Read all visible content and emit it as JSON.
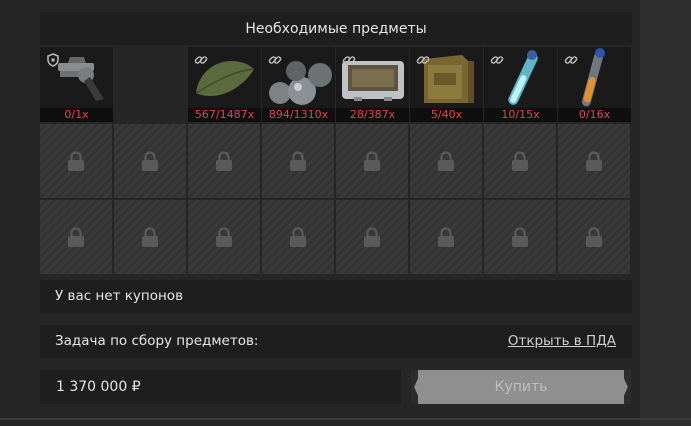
{
  "header": {
    "title": "Необходимые предметы"
  },
  "items": [
    {
      "name": "revolver",
      "count": "0/1x",
      "tag": "shield-icon"
    },
    {
      "name": "leaf",
      "count": "567/1487x",
      "tag": "link-icon"
    },
    {
      "name": "metal-balls",
      "count": "894/1310x",
      "tag": "link-icon"
    },
    {
      "name": "case",
      "count": "28/387x",
      "tag": "link-icon"
    },
    {
      "name": "ammo-box",
      "count": "5/40x",
      "tag": "link-icon"
    },
    {
      "name": "glow-tube",
      "count": "10/15x",
      "tag": "link-icon"
    },
    {
      "name": "orange-vial",
      "count": "0/16x",
      "tag": "link-icon"
    }
  ],
  "locked_slots": {
    "rows": 2,
    "cols": 8,
    "icon": "lock-icon"
  },
  "coupons": {
    "text": "У вас нет купонов"
  },
  "task": {
    "label": "Задача по сбору предметов:",
    "link": "Открыть в ПДА"
  },
  "purchase": {
    "price": "1 370 000 ₽",
    "button": "Купить"
  },
  "colors": {
    "count_red": "#e0454b",
    "panel_bg": "#1e1e1e",
    "button_disabled": "#8f8f8f"
  }
}
